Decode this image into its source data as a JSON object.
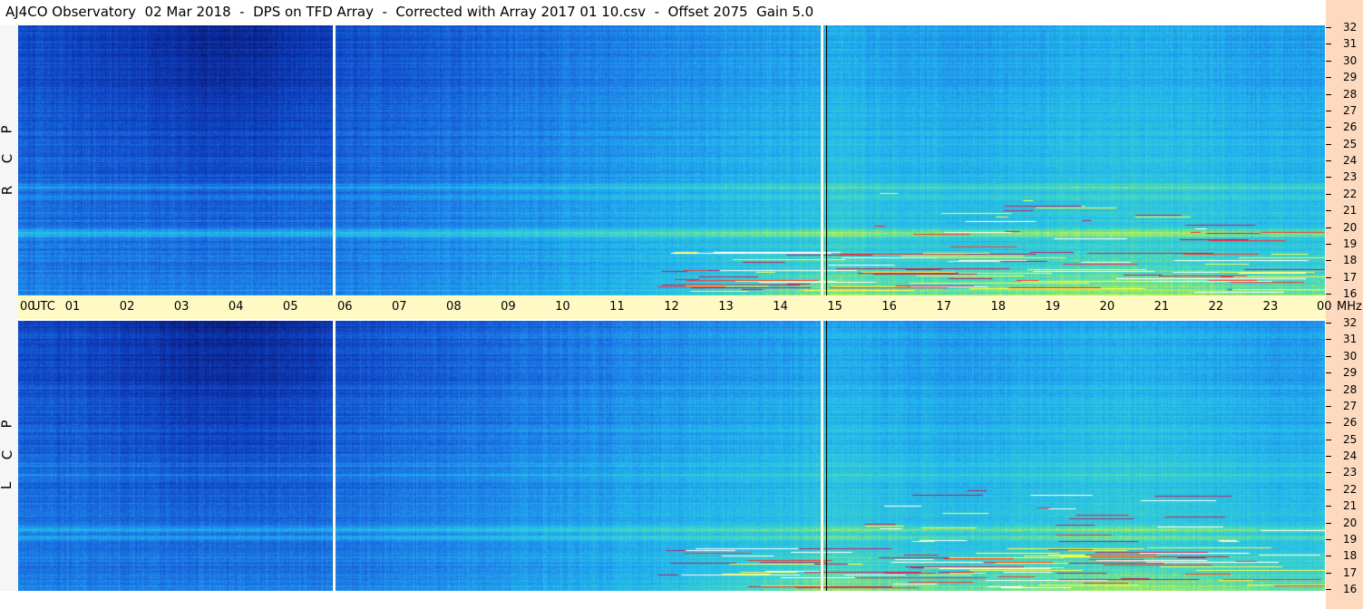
{
  "title": "AJ4CO Observatory  02 Mar 2018  -  DPS on TFD Array  -  Corrected with Array 2017 01 10.csv  -  Offset 2075  Gain 5.0",
  "chart_data": {
    "type": "heatmap",
    "title": "AJ4CO Observatory  02 Mar 2018  -  DPS on TFD Array  -  Corrected with Array 2017 01 10.csv  -  Offset 2075  Gain 5.0",
    "x_axis": {
      "unit_label": "UTC",
      "ticks": [
        "00",
        "01",
        "02",
        "03",
        "04",
        "05",
        "06",
        "07",
        "08",
        "09",
        "10",
        "11",
        "12",
        "13",
        "14",
        "15",
        "16",
        "17",
        "18",
        "19",
        "20",
        "21",
        "22",
        "23",
        "00"
      ],
      "range_hours": [
        0,
        24
      ]
    },
    "y_axis": {
      "unit_label": "MHz",
      "ticks": [
        "32",
        "31",
        "30",
        "29",
        "28",
        "27",
        "26",
        "25",
        "24",
        "23",
        "22",
        "21",
        "20",
        "19",
        "18",
        "17",
        "16"
      ],
      "range_mhz": [
        16,
        32
      ]
    },
    "panels": [
      {
        "name": "R C P",
        "letters": [
          "R",
          "C",
          "P"
        ]
      },
      {
        "name": "L C P",
        "letters": [
          "L",
          "C",
          "P"
        ]
      }
    ],
    "colormap": [
      "#000010",
      "#0a1f86",
      "#1046c8",
      "#1e7ee8",
      "#22b8ee",
      "#3fd6c8",
      "#b6f04a",
      "#ffff40",
      "#ff4040",
      "#ffffff"
    ],
    "data_gaps_utc_hours": [
      5.8,
      14.75
    ],
    "daybreak_utc_hour": 14.8
  }
}
